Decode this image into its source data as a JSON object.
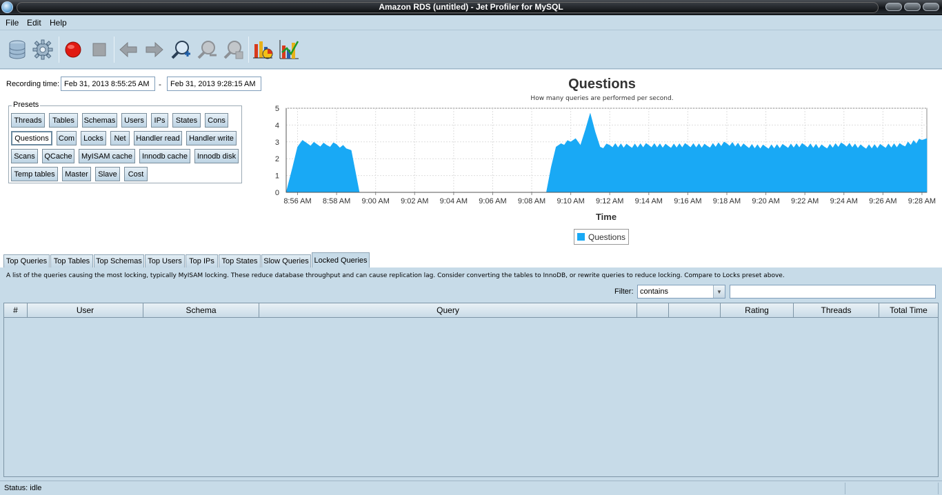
{
  "window": {
    "title": "Amazon RDS (untitled) - Jet Profiler for MySQL"
  },
  "menu": {
    "file": "File",
    "edit": "Edit",
    "help": "Help"
  },
  "toolbar": {
    "icons": [
      "database-icon",
      "gear-icon",
      "record-icon",
      "stop-icon",
      "back-arrow-icon",
      "forward-arrow-icon",
      "zoom-in-icon",
      "zoom-out-icon",
      "zoom-fit-icon",
      "pie-chart-icon",
      "bar-chart-icon"
    ]
  },
  "recording": {
    "label": "Recording time:",
    "start": "Feb 31, 2013 8:55:25 AM",
    "separator": "-",
    "end": "Feb 31, 2013 9:28:15 AM"
  },
  "presets": {
    "legend": "Presets",
    "rows": [
      [
        "Threads",
        "Tables",
        "Schemas",
        "Users",
        "IPs",
        "States",
        "Cons"
      ],
      [
        "Questions",
        "Com",
        "Locks",
        "Net",
        "Handler read",
        "Handler write"
      ],
      [
        "Scans",
        "QCache",
        "MyISAM cache",
        "Innodb cache",
        "Innodb disk"
      ],
      [
        "Temp tables",
        "Master",
        "Slave",
        "Cost"
      ]
    ],
    "active": "Questions"
  },
  "chart_data": {
    "type": "area",
    "title": "Questions",
    "subtitle": "How many queries are performed per second.",
    "xlabel": "Time",
    "ylabel": "",
    "ylim": [
      0,
      5
    ],
    "yticks": [
      "0",
      "1",
      "2",
      "3",
      "4",
      "5"
    ],
    "xticks": [
      "8:56 AM",
      "8:58 AM",
      "9:00 AM",
      "9:02 AM",
      "9:04 AM",
      "9:06 AM",
      "9:08 AM",
      "9:10 AM",
      "9:12 AM",
      "9:14 AM",
      "9:16 AM",
      "9:18 AM",
      "9:20 AM",
      "9:22 AM",
      "9:24 AM",
      "9:26 AM",
      "9:28 AM"
    ],
    "grid": true,
    "legend_position": "bottom",
    "color": "#19a9f5",
    "series": [
      {
        "name": "Questions",
        "x": [
          "8:55:25",
          "8:55:45",
          "8:56:00",
          "8:56:15",
          "8:56:30",
          "8:57:00",
          "8:57:30",
          "8:58:00",
          "8:58:30",
          "8:58:45",
          "8:59:00",
          "8:59:10",
          "9:00:00",
          "9:02:00",
          "9:04:00",
          "9:06:00",
          "9:08:00",
          "9:08:45",
          "9:09:00",
          "9:09:15",
          "9:09:30",
          "9:10:00",
          "9:10:15",
          "9:10:30",
          "9:10:45",
          "9:11:00",
          "9:11:15",
          "9:11:30",
          "9:12:00",
          "9:13:00",
          "9:14:00",
          "9:15:00",
          "9:16:00",
          "9:17:00",
          "9:18:00",
          "9:19:00",
          "9:20:00",
          "9:21:00",
          "9:22:00",
          "9:23:00",
          "9:24:00",
          "9:25:00",
          "9:26:00",
          "9:27:00",
          "9:28:00",
          "9:28:15"
        ],
        "values": [
          0,
          1.5,
          2.7,
          3.1,
          2.9,
          2.85,
          2.8,
          2.85,
          2.6,
          2.5,
          1.0,
          0,
          0,
          0,
          0,
          0,
          0,
          0,
          1.5,
          2.7,
          2.9,
          3.0,
          3.2,
          2.8,
          3.7,
          4.7,
          3.6,
          2.7,
          2.8,
          2.75,
          2.8,
          2.75,
          2.8,
          2.75,
          2.9,
          2.75,
          2.7,
          2.75,
          2.8,
          2.7,
          2.85,
          2.7,
          2.75,
          2.8,
          3.1,
          3.2
        ]
      }
    ]
  },
  "tabs": [
    "Top Queries",
    "Top Tables",
    "Top Schemas",
    "Top Users",
    "Top IPs",
    "Top States",
    "Slow Queries",
    "Locked Queries"
  ],
  "active_tab": "Locked Queries",
  "locked": {
    "description": "A list of the queries causing the most locking, typically MyISAM locking. These reduce database throughput and can cause replication lag. Consider converting the tables to InnoDB, or rewrite queries to reduce locking. Compare to Locks preset above.",
    "filter_label": "Filter:",
    "filter_mode": "contains",
    "filter_value": "",
    "columns": [
      "#",
      "User",
      "Schema",
      "Query",
      "",
      "",
      "Rating",
      "Threads",
      "Total Time"
    ]
  },
  "status": {
    "text": "Status: idle"
  }
}
